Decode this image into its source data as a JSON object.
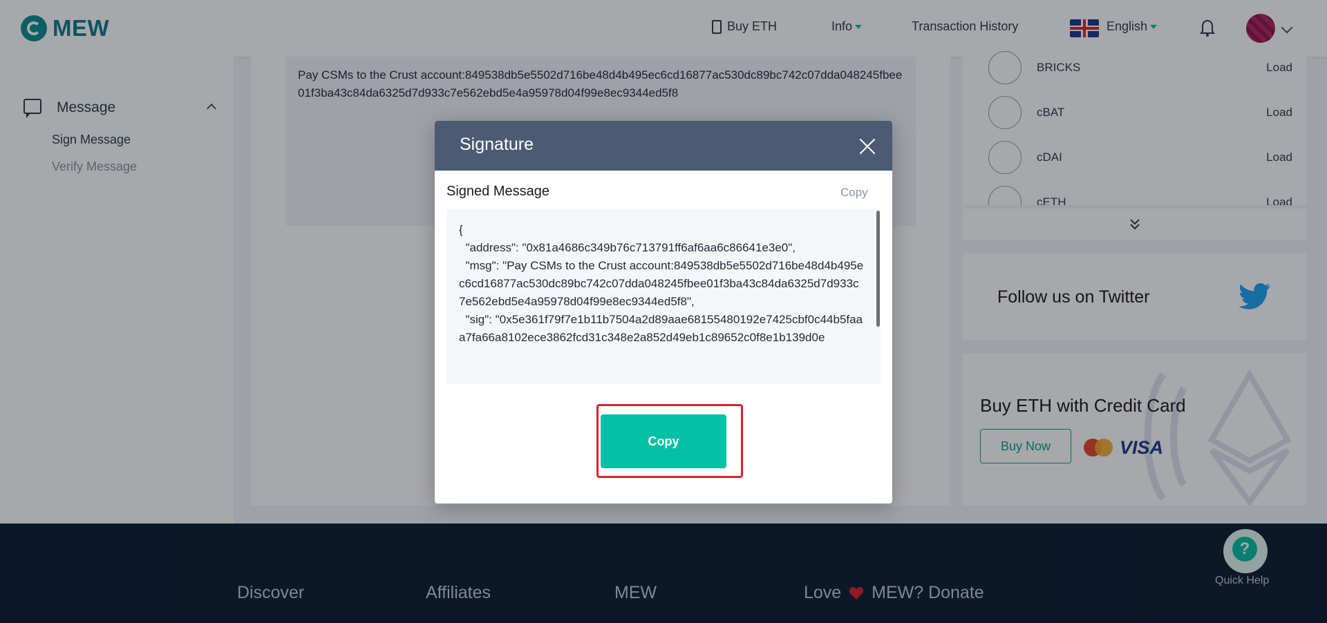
{
  "header": {
    "logo_text": "MEW",
    "nav": {
      "buy_eth": "Buy ETH",
      "info": "Info",
      "transaction_history": "Transaction History",
      "language": "English"
    }
  },
  "sidebar": {
    "section_label": "Message",
    "items": [
      {
        "label": "Sign Message"
      },
      {
        "label": "Verify Message"
      }
    ]
  },
  "main": {
    "message_text": "Pay CSMs to the Crust account:849538db5e5502d716be48d4b495ec6cd16877ac530dc89bc742c07dda048245fbee01f3ba43c84da6325d7d933c7e562ebd5e4a95978d04f99e8ec9344ed5f8"
  },
  "tokens": [
    {
      "name": "BRICKS",
      "action": "Load"
    },
    {
      "name": "cBAT",
      "action": "Load"
    },
    {
      "name": "cDAI",
      "action": "Load"
    },
    {
      "name": "cETH",
      "action": "Load"
    }
  ],
  "twitter": {
    "text": "Follow us on Twitter"
  },
  "buy_card": {
    "title": "Buy ETH with Credit Card",
    "button": "Buy Now",
    "visa": "VISA"
  },
  "footer": {
    "discover": "Discover",
    "affiliates": "Affiliates",
    "mew": "MEW",
    "love": "Love",
    "donate": "MEW? Donate",
    "quick_help": "Quick Help"
  },
  "modal": {
    "title": "Signature",
    "signed_label": "Signed Message",
    "copy_link": "Copy",
    "signed_json": "{\n  \"address\": \"0x81a4686c349b76c713791ff6af6aa6c86641e3e0\",\n  \"msg\": \"Pay CSMs to the Crust account:849538db5e5502d716be48d4b495ec6cd16877ac530dc89bc742c07dda048245fbee01f3ba43c84da6325d7d933c7e562ebd5e4a95978d04f99e8ec9344ed5f8\",\n  \"sig\": \"0x5e361f79f7e1b11b7504a2d89aae68155480192e7425cbf0c44b5faaa7fa66a8102ece3862fcd31c348e2a852d49eb1c89652c0f8e1b139d0e",
    "copy_button": "Copy"
  },
  "colors": {
    "accent": "#05c0a5",
    "modal_header": "#4b5b73",
    "footer_bg": "#0b1e33",
    "highlight": "#e0202a"
  }
}
